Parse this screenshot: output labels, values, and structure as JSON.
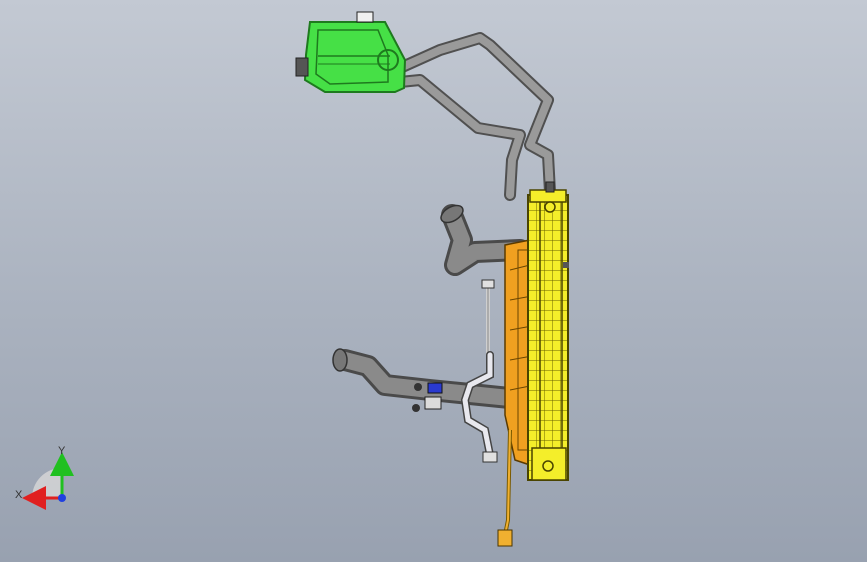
{
  "viewport": {
    "background_top": "#c3c9d3",
    "background_bottom": "#98a1b0"
  },
  "model": {
    "parts": {
      "expansion_tank": {
        "color": "#3ee43e",
        "icon": "expansion-tank"
      },
      "radiator": {
        "color": "#f2ea1c",
        "icon": "radiator"
      },
      "fan_shroud": {
        "color": "#f2a31c",
        "icon": "fan-shroud"
      },
      "coolant_pipes": {
        "color": "#8c8c8c",
        "icon": "pipe"
      }
    }
  },
  "triad": {
    "x_label": "X",
    "y_label": "Y",
    "x_color": "#e02020",
    "y_color": "#20c020",
    "z_color": "#2040e0"
  }
}
